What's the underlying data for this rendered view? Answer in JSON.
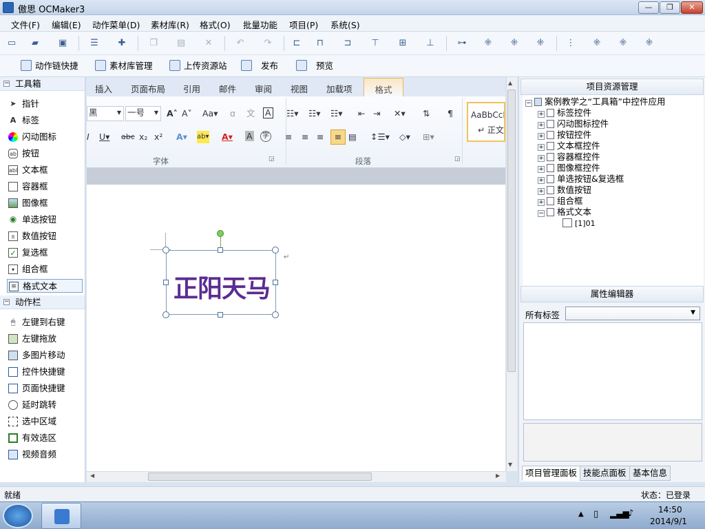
{
  "window": {
    "title": "傲思 OCMaker3",
    "min": "—",
    "max": "❐",
    "close": "✕"
  },
  "menu": [
    "文件(F)",
    "编辑(E)",
    "动作菜单(D)",
    "素材库(R)",
    "格式(O)",
    "批量功能",
    "项目(P)",
    "系统(S)"
  ],
  "toolbar2": [
    "动作链快捷",
    "素材库管理",
    "上传资源站",
    "发布",
    "预览"
  ],
  "toolbox": {
    "group1": "工具箱",
    "tools": [
      "指针",
      "标签",
      "闪动图标",
      "按钮",
      "文本框",
      "容器框",
      "图像框",
      "单选按钮",
      "数值按钮",
      "复选框",
      "组合框",
      "格式文本"
    ],
    "group2": "动作栏",
    "actions": [
      "左键到右键",
      "左键拖放",
      "多图片移动",
      "控件快捷键",
      "页面快捷键",
      "延时跳转",
      "选中区域",
      "有效选区",
      "视频音频"
    ]
  },
  "ribbon": {
    "tabs": [
      "插入",
      "页面布局",
      "引用",
      "邮件",
      "审阅",
      "视图",
      "加载项",
      "格式"
    ],
    "font_name": "黑",
    "font_size": "一号",
    "group_font": "字体",
    "group_para": "段落",
    "style_preview": "AaBbCcI",
    "style_name": "↵ 正文"
  },
  "canvas": {
    "text": "正阳天马"
  },
  "right": {
    "project_header": "项目资源管理",
    "root": "案例教学之“工具箱”中控件应用",
    "nodes": [
      "标签控件",
      "闪动图标控件",
      "按钮控件",
      "文本框控件",
      "容器框控件",
      "图像框控件",
      "单选按钮&复选框",
      "数值按钮",
      "组合框",
      "格式文本"
    ],
    "leaf": "[1]01",
    "prop_header": "属性编辑器",
    "all_tags": "所有标签",
    "tabs": [
      "项目管理面板",
      "技能点面板",
      "基本信息"
    ]
  },
  "status": {
    "left": "就绪",
    "right": "状态：已登录"
  },
  "taskbar": {
    "time": "14:50",
    "date": "2014/9/1"
  }
}
